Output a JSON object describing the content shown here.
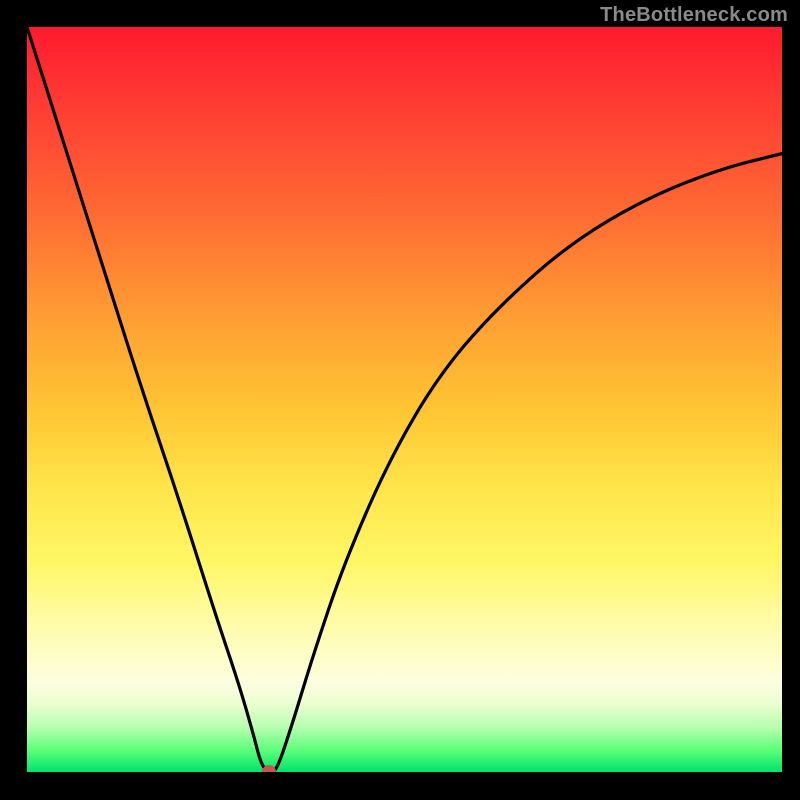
{
  "watermark": {
    "text": "TheBottleneck.com"
  },
  "colors": {
    "background": "#000000",
    "curve": "#000000",
    "marker": "#c6554f",
    "watermark": "#8a8a8a"
  },
  "chart_data": {
    "type": "line",
    "title": "",
    "xlabel": "",
    "ylabel": "",
    "xlim": [
      0,
      100
    ],
    "ylim": [
      0,
      100
    ],
    "grid": false,
    "legend": false,
    "annotations": [
      {
        "type": "marker",
        "x": 32,
        "y": 0,
        "color": "#c6554f"
      }
    ],
    "series": [
      {
        "name": "bottleneck-curve",
        "x": [
          0,
          5,
          10,
          15,
          20,
          25,
          28,
          30,
          31,
          32,
          33,
          35,
          38,
          42,
          48,
          55,
          63,
          72,
          82,
          92,
          100
        ],
        "y": [
          100,
          84,
          68,
          52,
          37,
          21,
          12,
          5,
          1,
          0,
          0,
          6,
          16,
          28,
          42,
          54,
          63,
          71,
          77,
          81,
          83
        ]
      }
    ],
    "background_gradient": {
      "stops": [
        {
          "pos": 0,
          "color": "#ff1a2e"
        },
        {
          "pos": 10,
          "color": "#ff3a33"
        },
        {
          "pos": 25,
          "color": "#ff6a33"
        },
        {
          "pos": 40,
          "color": "#ffa133"
        },
        {
          "pos": 52,
          "color": "#ffc733"
        },
        {
          "pos": 62,
          "color": "#ffe54a"
        },
        {
          "pos": 72,
          "color": "#fff766"
        },
        {
          "pos": 80,
          "color": "#fffca8"
        },
        {
          "pos": 88,
          "color": "#fdfee0"
        },
        {
          "pos": 91,
          "color": "#e9ffcf"
        },
        {
          "pos": 94,
          "color": "#b6ffb0"
        },
        {
          "pos": 97,
          "color": "#5eff7a"
        },
        {
          "pos": 100,
          "color": "#00e46b"
        }
      ]
    }
  }
}
